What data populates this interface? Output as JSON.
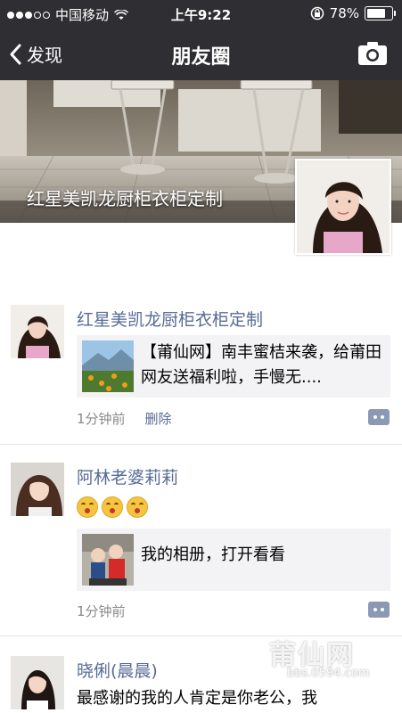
{
  "status_bar": {
    "carrier": "中国移动",
    "time": "上午9:22",
    "battery_percent": "78%",
    "battery_level": 0.78,
    "signal_bars": 3
  },
  "nav": {
    "back_label": "发现",
    "title": "朋友圈",
    "camera_icon": "camera-icon"
  },
  "cover": {
    "caption": "红星美凯龙厨柜衣柜定制"
  },
  "posts": [
    {
      "name": "红星美凯龙厨柜衣柜定制",
      "link_text": "【莆仙网】南丰蜜桔来袭，给莆田网友送福利啦，手慢无....",
      "time": "1分钟前",
      "delete_label": "删除"
    },
    {
      "name": "阿林老婆莉莉",
      "emoji_count": 3,
      "link_text": "我的相册，打开看看",
      "time": "1分钟前"
    },
    {
      "name": "晓俐(晨晨)",
      "text": "最感谢的我的人肯定是你老公，我"
    }
  ],
  "watermark": {
    "logo": "莆仙网",
    "url": "bbs.0594.com"
  },
  "colors": {
    "nav_bg": "#2f2f33",
    "name_link": "#576b95",
    "card_bg": "#f3f3f5"
  }
}
